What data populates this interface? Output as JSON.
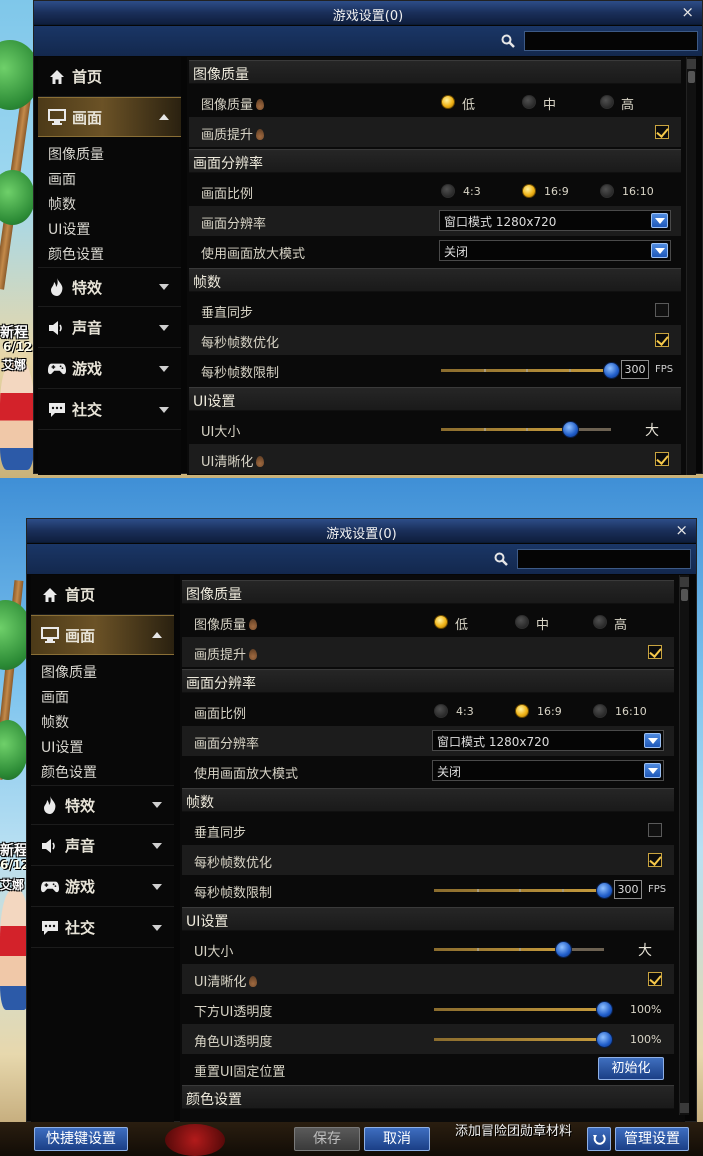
{
  "window": {
    "title": "游戏设置(0)",
    "close_glyph": "×",
    "search_placeholder": ""
  },
  "nav": {
    "home": "首页",
    "display": "画面",
    "display_subitems": [
      "图像质量",
      "画面",
      "帧数",
      "UI设置",
      "颜色设置"
    ],
    "effects": "特效",
    "sound": "声音",
    "game": "游戏",
    "social": "社交"
  },
  "sections": {
    "image_quality": {
      "title": "图像质量",
      "quality_label": "图像质量",
      "quality_options": [
        "低",
        "中",
        "高"
      ],
      "quality_selected": "低",
      "enhance_label": "画质提升",
      "enhance_checked": true
    },
    "resolution": {
      "title": "画面分辨率",
      "ratio_label": "画面比例",
      "ratio_options": [
        "4:3",
        "16:9",
        "16:10"
      ],
      "ratio_selected": "16:9",
      "res_label": "画面分辨率",
      "res_value": "窗口模式 1280x720",
      "zoom_label": "使用画面放大模式",
      "zoom_value": "关闭"
    },
    "fps": {
      "title": "帧数",
      "vsync_label": "垂直同步",
      "vsync_checked": false,
      "opt_label": "每秒帧数优化",
      "opt_checked": true,
      "limit_label": "每秒帧数限制",
      "limit_value": "300",
      "limit_unit": "FPS",
      "limit_fraction": 1.0
    },
    "ui": {
      "title": "UI设置",
      "size_label": "UI大小",
      "size_value_text": "大",
      "size_fraction": 0.76,
      "sharp_label": "UI清晰化",
      "sharp_checked": true,
      "bottom_alpha_label": "下方UI透明度",
      "bottom_alpha_value": "100%",
      "bottom_alpha_fraction": 1.0,
      "char_alpha_label": "角色UI透明度",
      "char_alpha_value": "100%",
      "char_alpha_fraction": 1.0,
      "reset_label": "重置UI固定位置",
      "reset_button": "初始化"
    },
    "color": {
      "title": "颜色设置"
    }
  },
  "bottom": {
    "shortcut_button": "快捷键设置",
    "save_button": "保存",
    "cancel_button": "取消",
    "hint_text": "添加冒险团勋章材料",
    "manage_button": "管理设置"
  },
  "background": {
    "side_label_1": "新程",
    "side_label_2": "6/12",
    "side_label_3": "艾娜"
  }
}
